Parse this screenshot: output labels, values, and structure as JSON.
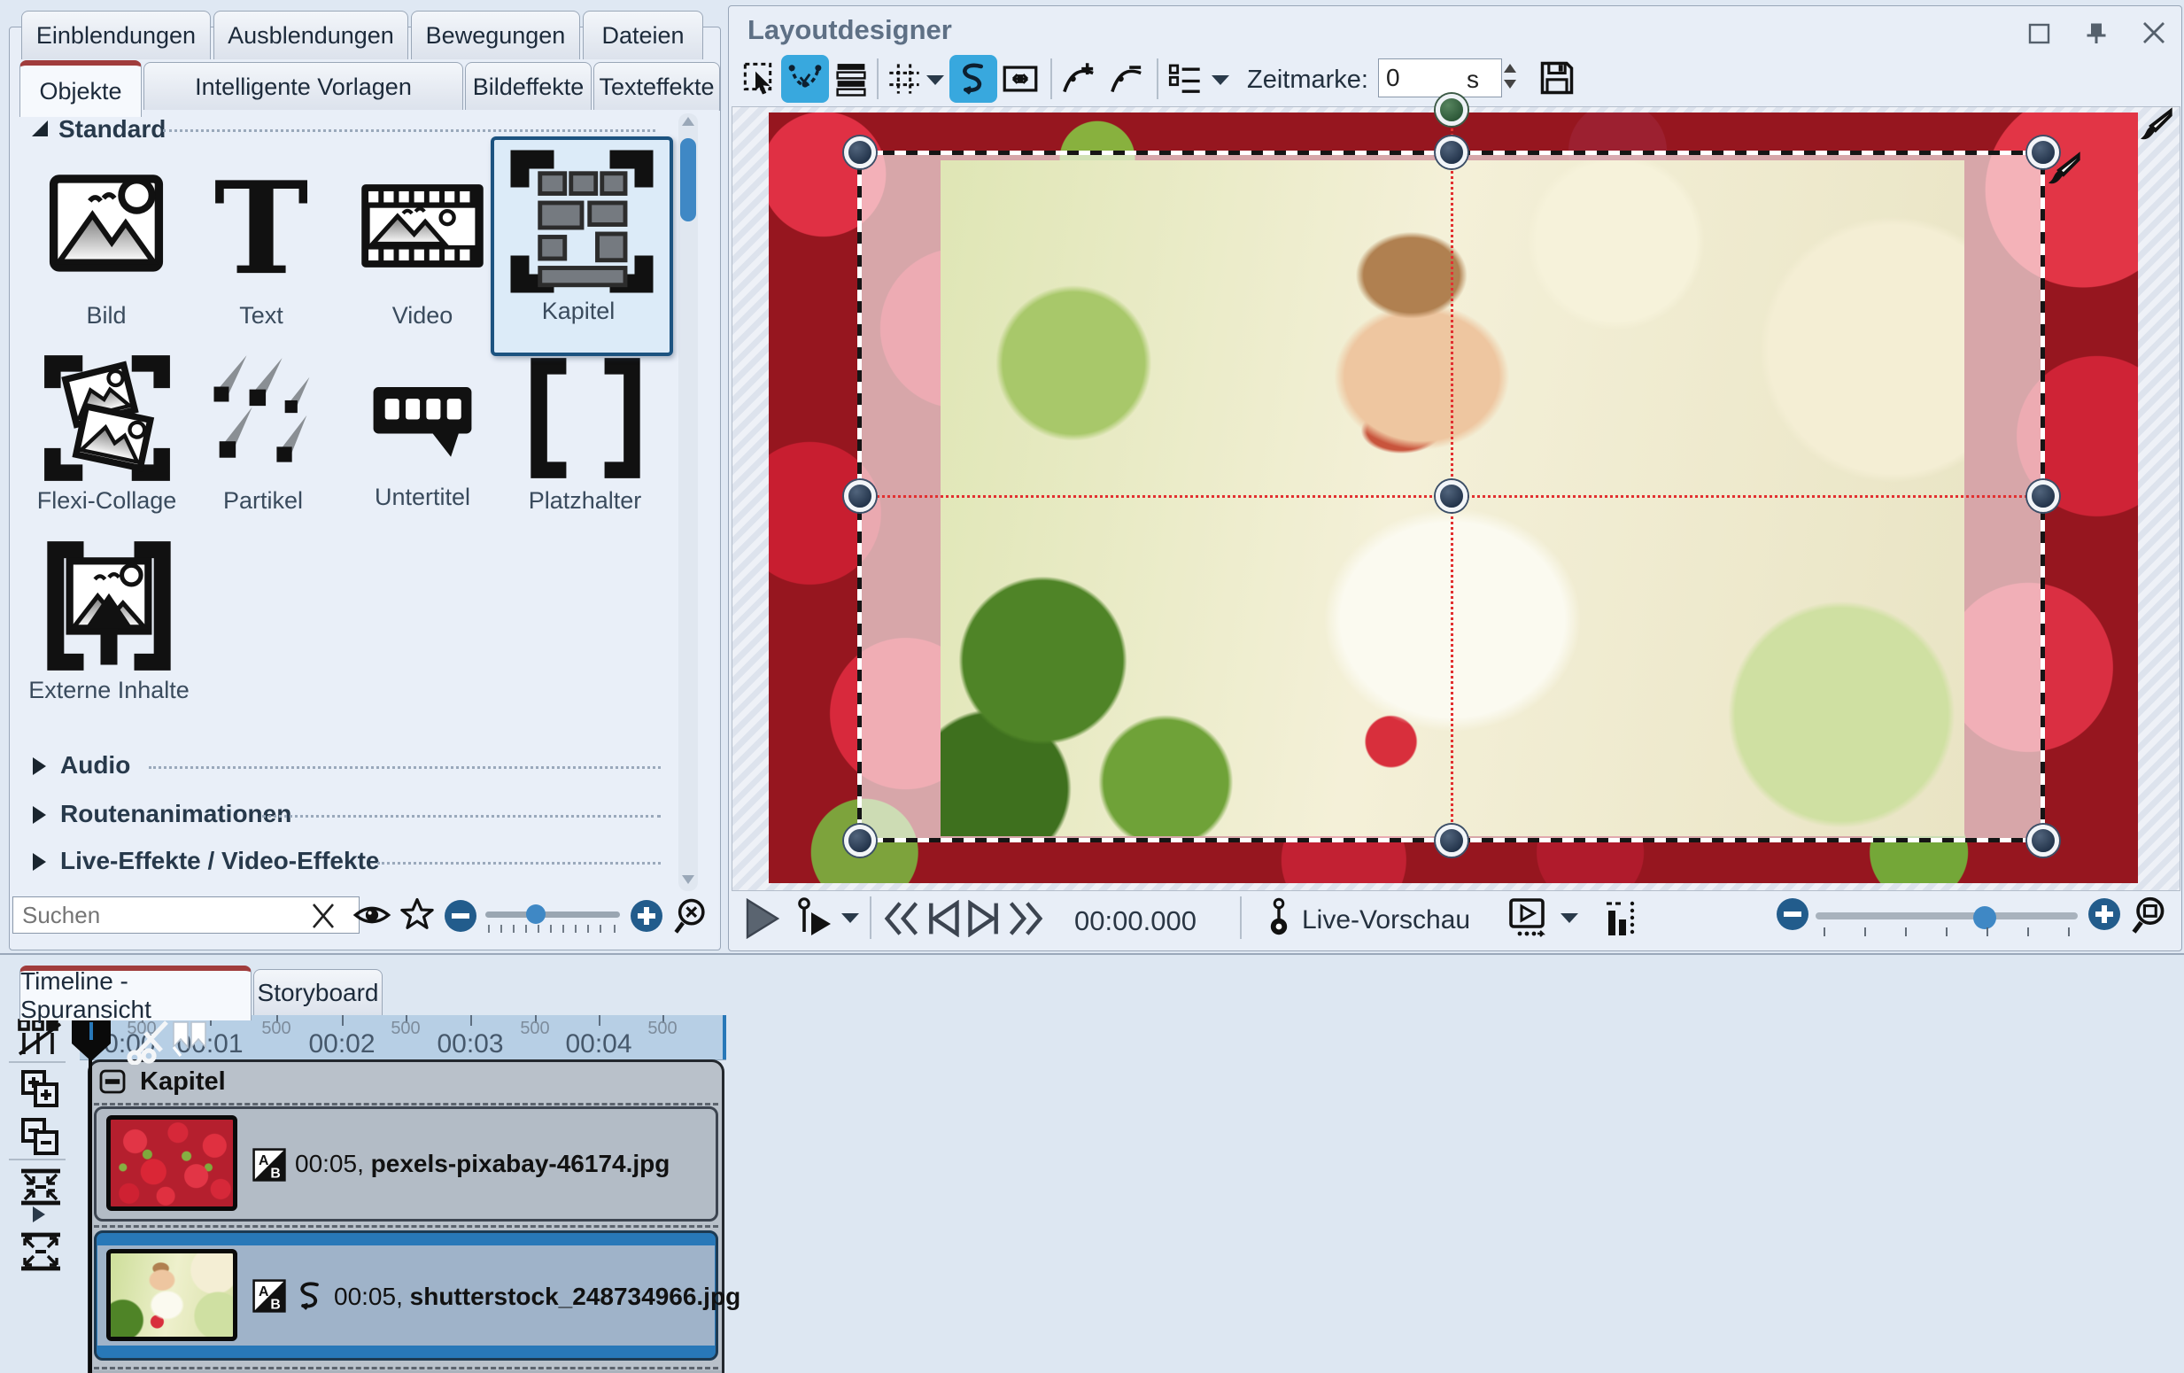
{
  "left_panel": {
    "tabs_row1": [
      {
        "label": "Einblendungen"
      },
      {
        "label": "Ausblendungen"
      },
      {
        "label": "Bewegungen"
      },
      {
        "label": "Dateien"
      }
    ],
    "tabs_row2": [
      {
        "label": "Objekte",
        "active": true
      },
      {
        "label": "Intelligente Vorlagen"
      },
      {
        "label": "Bildeffekte"
      },
      {
        "label": "Texteffekte"
      }
    ],
    "sections": {
      "standard": "Standard",
      "audio": "Audio",
      "routen": "Routenanimationen",
      "live": "Live-Effekte / Video-Effekte"
    },
    "items": [
      {
        "label": "Bild"
      },
      {
        "label": "Text"
      },
      {
        "label": "Video"
      },
      {
        "label": "Kapitel",
        "selected": true
      },
      {
        "label": "Flexi-Collage"
      },
      {
        "label": "Partikel"
      },
      {
        "label": "Untertitel"
      },
      {
        "label": "Platzhalter"
      },
      {
        "label": "Externe Inhalte"
      }
    ],
    "search_placeholder": "Suchen"
  },
  "layoutdesigner": {
    "title": "Layoutdesigner",
    "toolbar": {
      "zeitmarke_label": "Zeitmarke:",
      "zeitmarke_value": "0",
      "zeitmarke_unit": "s"
    },
    "playback": {
      "time": "00:00.000",
      "live_preview": "Live-Vorschau"
    }
  },
  "timeline": {
    "tabs": [
      {
        "label": "Timeline - Spuransicht",
        "active": true
      },
      {
        "label": "Storyboard"
      }
    ],
    "track": {
      "name": "Kapitel"
    },
    "ruler": {
      "majors": [
        "00:00",
        "00:01",
        "00:02",
        "00:03",
        "00:04"
      ],
      "minor": "500"
    },
    "clips": [
      {
        "duration": "00:05,",
        "filename": "pexels-pixabay-46174.jpg",
        "selected": false
      },
      {
        "duration": "00:05,",
        "filename": "shutterstock_248734966.jpg",
        "selected": true
      }
    ]
  },
  "colors": {
    "accent_blue": "#38a8de",
    "selection_blue": "#2b7ab8",
    "active_tab_red": "#a03c3c",
    "handle_navy": "#22334a",
    "rotation_green": "#2c5737",
    "ruler_blue": "#b7cfe5"
  }
}
